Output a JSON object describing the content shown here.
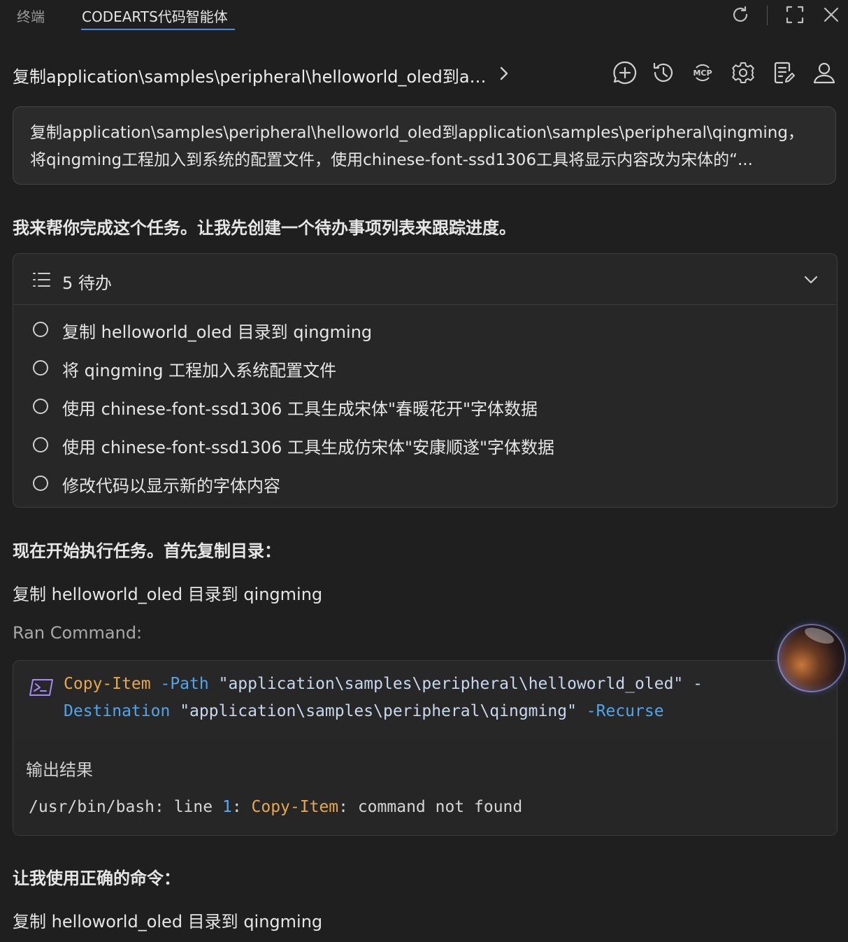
{
  "tabs": {
    "terminal": "终端",
    "agent": "CODEARTS代码智能体"
  },
  "toolbar_icons": [
    "refresh-icon",
    "maximize-icon",
    "close-icon"
  ],
  "header": {
    "title": "复制application\\samples\\peripheral\\helloworld_oled到ap...",
    "icons": [
      "new-chat-icon",
      "history-icon",
      "mcp-icon",
      "settings-icon",
      "rules-icon",
      "account-icon"
    ],
    "mcp_label": "MCP"
  },
  "prompt": {
    "line1": "复制application\\samples\\peripheral\\helloworld_oled到application\\samples\\peripheral\\qingming，",
    "line2": "将qingming工程加入到系统的配置文件，使用chinese-font-ssd1306工具将显示内容改为宋体的“..."
  },
  "messages": {
    "intro": "我来帮你完成这个任务。让我先创建一个待办事项列表来跟踪进度。",
    "start": "现在开始执行任务。首先复制目录：",
    "step1": "复制 helloworld_oled 目录到 qingming",
    "ran_command": "Ran Command:",
    "retry": "让我使用正确的命令：",
    "step1_again": "复制 helloworld_oled 目录到 qingming"
  },
  "todo": {
    "title": "5 待办",
    "items": [
      "复制 helloworld_oled 目录到 qingming",
      "将 qingming 工程加入系统配置文件",
      "使用 chinese-font-ssd1306 工具生成宋体\"春暖花开\"字体数据",
      "使用 chinese-font-ssd1306 工具生成仿宋体\"安康顺遂\"字体数据",
      "修改代码以显示新的字体内容"
    ]
  },
  "command": {
    "cmdlet": "Copy-Item",
    "param_path": "-Path",
    "path_value": "\"application\\samples\\peripheral\\helloworld_oled\"",
    "dash": "-",
    "param_destination": "Destination",
    "destination_value": "\"application\\samples\\peripheral\\qingming\"",
    "param_recurse": "-Recurse",
    "output_title": "输出结果",
    "output_prefix": "/usr/bin/bash: line ",
    "output_line_no": "1",
    "output_colon": ": ",
    "output_cmd": "Copy-Item",
    "output_suffix": ": command not found"
  },
  "colors": {
    "background": "#1f1f1f",
    "accent": "#3b8eea",
    "cmdlet": "#e5a84b",
    "parameter": "#4fa6ee"
  }
}
